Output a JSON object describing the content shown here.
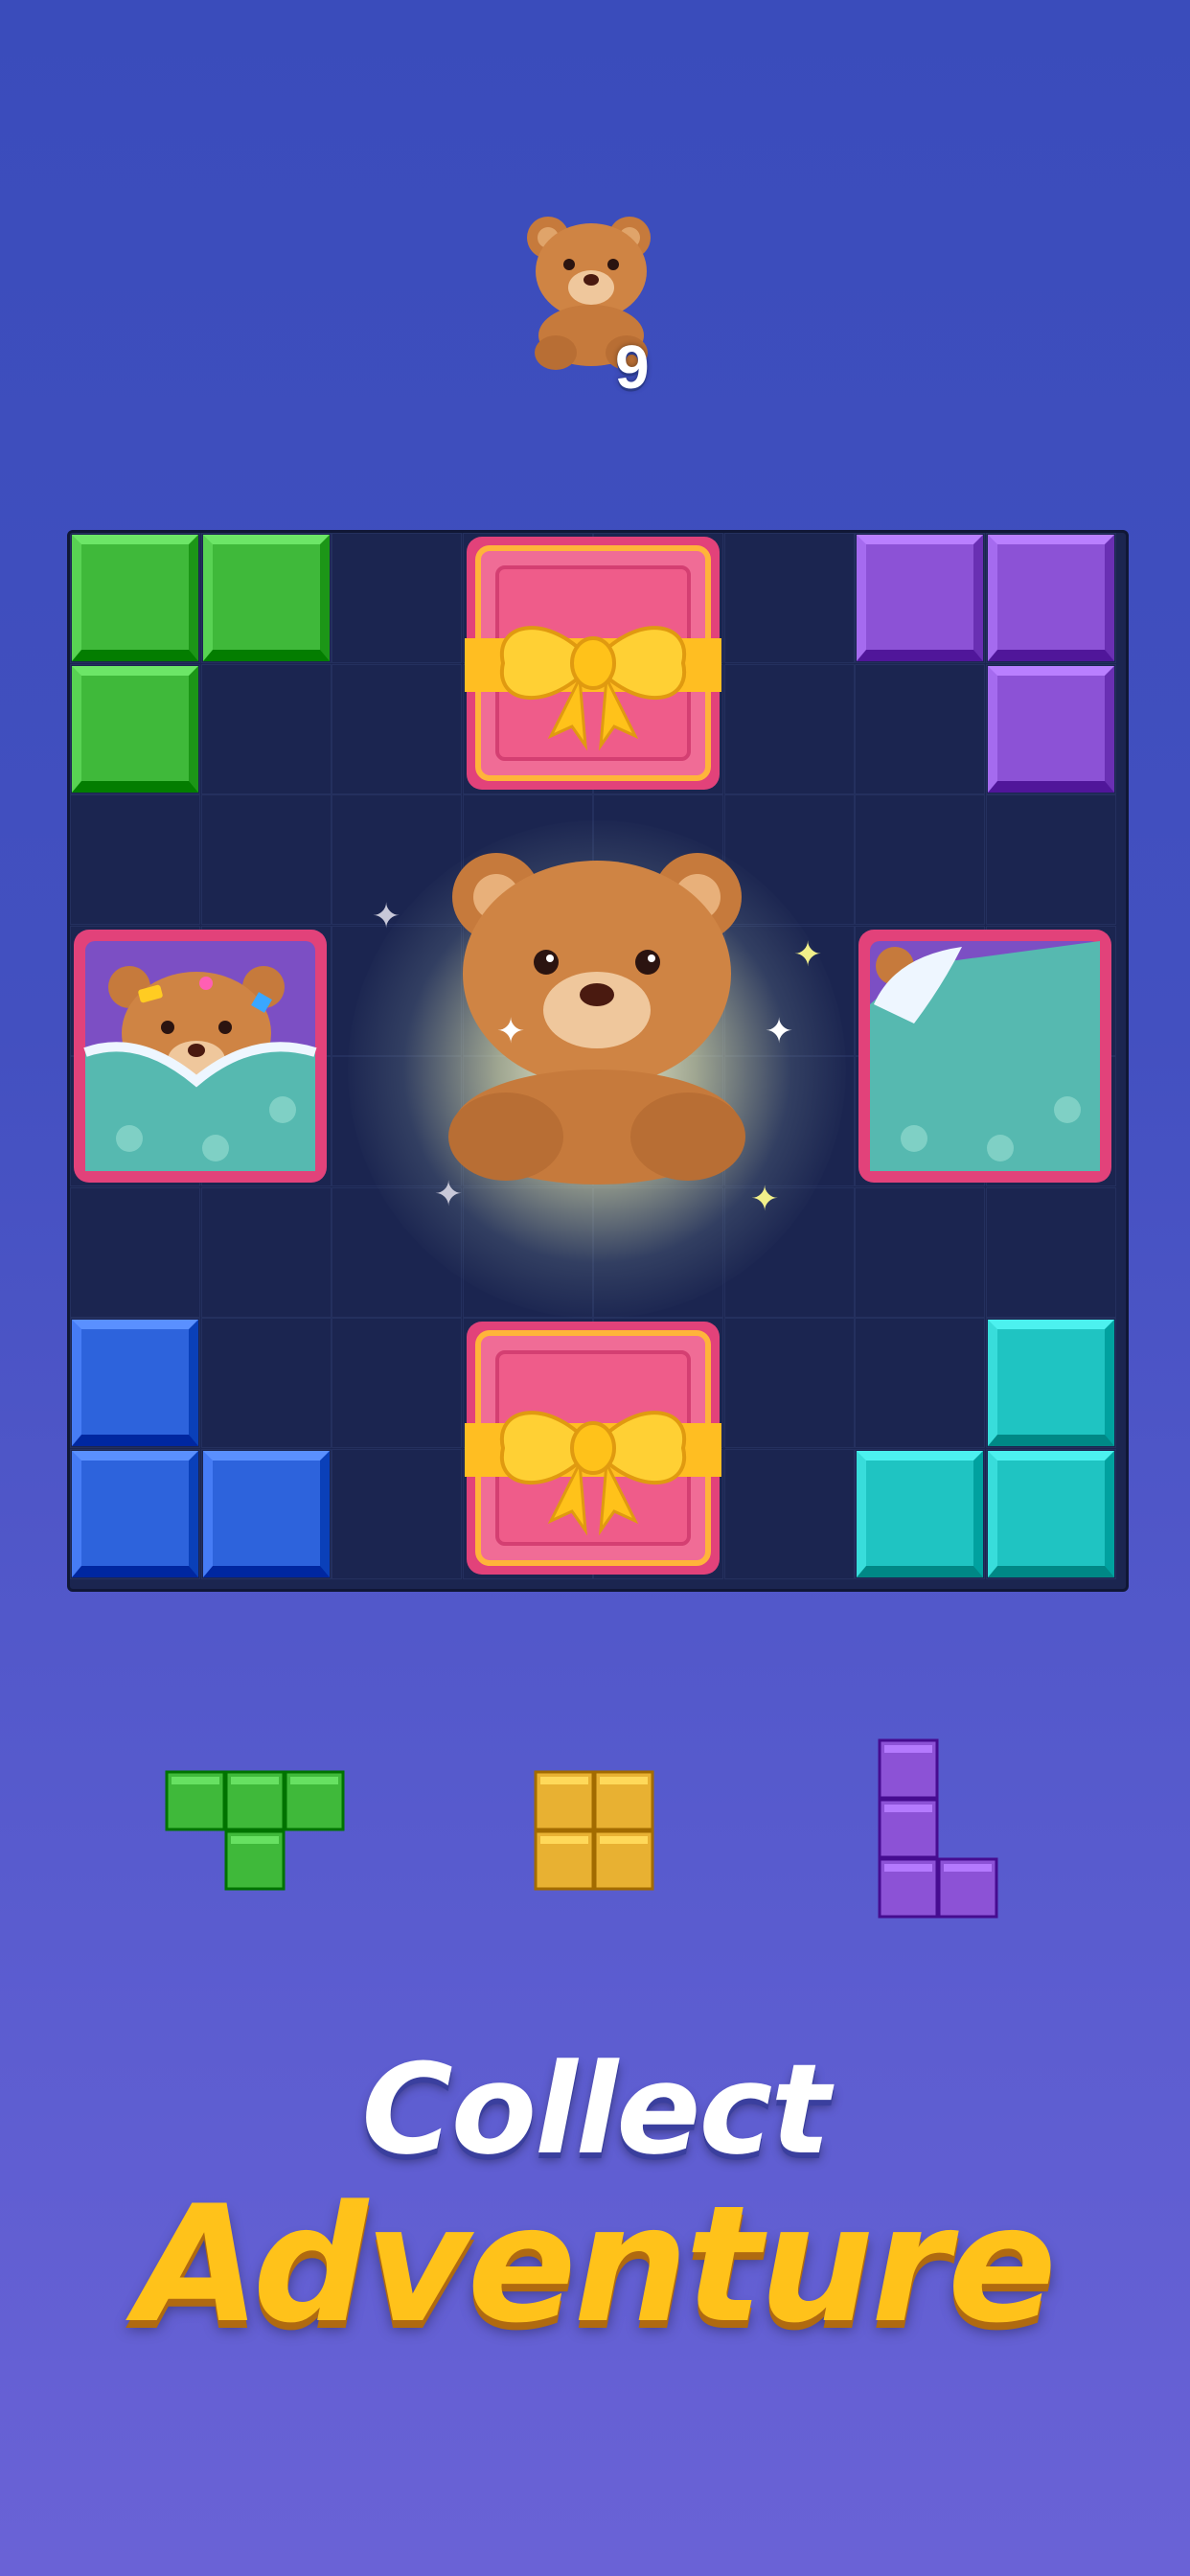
{
  "goal": {
    "icon": "teddy-bear-icon",
    "count": "9"
  },
  "board": {
    "colors": {
      "green": "#3fb93a",
      "purple": "#8c52d6",
      "blue": "#2d63dc",
      "teal": "#1fc4c2",
      "gift": "#ee5a8c",
      "ribbon": "#ffc524"
    }
  },
  "pieces": [
    {
      "name": "green-t-piece",
      "color": "#3fb93a"
    },
    {
      "name": "yellow-square-piece",
      "color": "#e8b132"
    },
    {
      "name": "purple-l-piece",
      "color": "#8c52d6"
    }
  ],
  "title": {
    "line1": "Collect",
    "line2": "Adventure"
  }
}
